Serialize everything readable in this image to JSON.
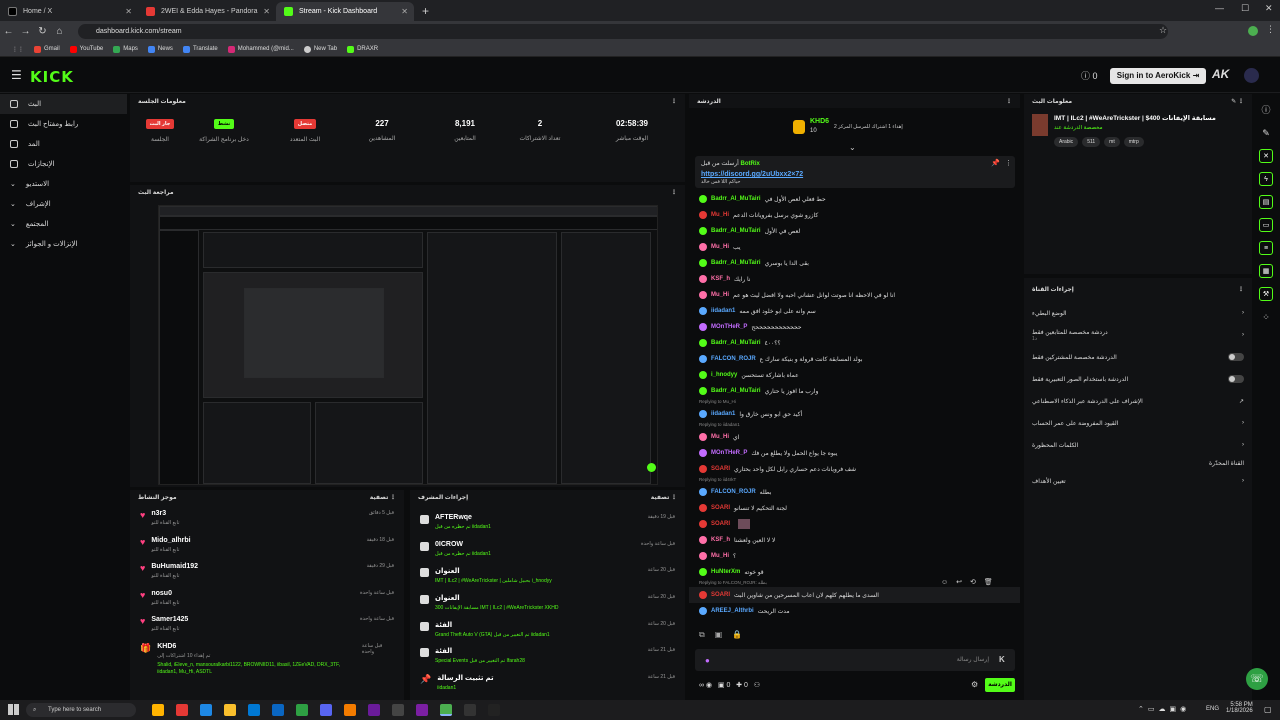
{
  "browser": {
    "tabs": [
      {
        "label": "Home / X",
        "favicon_color": "#000000",
        "active": false
      },
      {
        "label": "2WEI & Edda Hayes - Pandora",
        "favicon_color": "#e53935",
        "active": false
      },
      {
        "label": "Stream - Kick Dashboard",
        "favicon_color": "#53fc18",
        "active": true
      }
    ],
    "url": "dashboard.kick.com/stream",
    "bookmarks": [
      "Gmail",
      "YouTube",
      "Maps",
      "News",
      "Translate",
      "Mohammed (@mid...",
      "New Tab",
      "DRAXR"
    ]
  },
  "app": {
    "logo": "KICK",
    "notif_count": "0",
    "signin_label": "Sign in to AeroKick"
  },
  "sidebar": {
    "items": [
      {
        "label": "البث"
      },
      {
        "label": "رابط ومفتاح البث"
      },
      {
        "label": "المد"
      },
      {
        "label": "الإنجازات"
      },
      {
        "label": "الاستديو"
      },
      {
        "label": "الإشراف"
      },
      {
        "label": "المجتمع"
      },
      {
        "label": "الإنزالات و الجوائز"
      }
    ]
  },
  "session": {
    "title": "معلومات الجلسة",
    "stats": [
      {
        "value": "جار البث",
        "label": "الجلسة",
        "badge_color": "#e53935"
      },
      {
        "value": "نشط",
        "label": "دخل برنامج الشراكة",
        "badge_color": "#53fc18"
      },
      {
        "value": "متصل",
        "label": "البث المتعدد",
        "badge_color": "#e53935"
      },
      {
        "value": "227",
        "label": "المشاهدين"
      },
      {
        "value": "8,191",
        "label": "المتابعين"
      },
      {
        "value": "2",
        "label": "تعداد الاشتراكات"
      },
      {
        "value": "02:58:39",
        "label": "الوقت مباشر"
      }
    ]
  },
  "preview": {
    "title": "مراجعة البث"
  },
  "activity": {
    "title": "موجز النشاط",
    "filter_label": "تصفية",
    "items": [
      {
        "name": "n3r3",
        "sub": "تابع القناة للتو",
        "time": "قبل 5 دقائق"
      },
      {
        "name": "Mido_alhrbi",
        "sub": "تابع القناة للتو",
        "time": "قبل 18 دقيقة"
      },
      {
        "name": "BuHumaid192",
        "sub": "تابع القناة للتو",
        "time": "قبل 29 دقيقة"
      },
      {
        "name": "nosu0",
        "sub": "تابع القناة للتو",
        "time": "قبل ساعة واحدة"
      },
      {
        "name": "Samer1425",
        "sub": "تابع القناة للتو",
        "time": "قبل ساعة واحدة"
      },
      {
        "name": "KHD6",
        "sub": "تم إهداء 10 اشتراكات إلى",
        "extra": "Shalid, iEleve_n, mansouralkarbi1122, BROWNIID11, iibasil, 1ZEeVAD, DRX_3TF, iidadan1, Mu_Hi, ASDTL",
        "time": "قبل ساعة واحدة"
      }
    ]
  },
  "mod_actions": {
    "title": "إجراءات المشرف",
    "filter_label": "تصفية",
    "items": [
      {
        "name": "AFTERwqe",
        "sub": "تم حظره من قبل iidadan1",
        "time": "قبل 19 دقيقة"
      },
      {
        "name": "0ICROW",
        "sub": "تم حظره من قبل iidadan1",
        "time": "قبل ساعة واحدة"
      },
      {
        "name": "العنوان",
        "sub": "IMT | ILc2 | #WeAreTrickster | بحبيل شاملين i_hnodyy",
        "time": "قبل 20 ساعة"
      },
      {
        "name": "العنوان",
        "sub": "مسابقة الإيفانات 300 IMT | ILc2 | #WeAreTrickster XKHD",
        "time": "قبل 20 ساعة"
      },
      {
        "name": "الفئة",
        "sub": "Grand Theft Auto V (GTA) تم التغيير من قبل iidadan1",
        "time": "قبل 20 ساعة"
      },
      {
        "name": "الفئة",
        "sub": "Special Events تم التغيير من قبل Ifarah28",
        "time": "قبل 21 ساعة"
      },
      {
        "name": "تم تثبيت الرسالة",
        "sub": "iidadan1",
        "time": "قبل 21 ساعة"
      }
    ]
  },
  "chat": {
    "title": "الدردشة",
    "top_gifter": {
      "name": "KHD6",
      "count": "10",
      "note": "إهداء 1 اشتراك للمرسل المركز 2"
    },
    "pinned": {
      "user": "BotRix",
      "prefix": "أرسلت من قبل",
      "text": "https://discord.gg/2uUbxx2×72",
      "sub": "حياكم اللا فس خالد"
    },
    "messages": [
      {
        "user": "Badrr_Al_MuTairi",
        "color": "#53fc18",
        "text": "حط فعلي لعص الأول في"
      },
      {
        "user": "Mu_Hi",
        "color": "#e53935",
        "text": "كازرو شوي برسل بفرويانات الدعم"
      },
      {
        "user": "Badrr_Al_MuTairi",
        "color": "#53fc18",
        "text": "لعص في الأول"
      },
      {
        "user": "Mu_Hi",
        "color": "#ff6fa8",
        "text": "يب"
      },
      {
        "user": "Badrr_Al_MuTairi",
        "color": "#53fc18",
        "text": "بقى الدا يا بوسري"
      },
      {
        "user": "KSF_h",
        "color": "#ff6fa8",
        "text": "نا رايك"
      },
      {
        "user": "Mu_Hi",
        "color": "#ff6fa8",
        "text": "انا لو في الاحظه انا صوتت لوانل عشاني احبه ولا افضل ليث هو عم"
      },
      {
        "user": "iidadan1",
        "color": "#5aa9ff",
        "text": "سم وانه على ابو خلود افق ممه"
      },
      {
        "user": "MOnTHeR_P",
        "color": "#c36cff",
        "text": "ححححححححححححح"
      },
      {
        "user": "Badrr_Al_MuTairi",
        "color": "#53fc18",
        "text": "؟؟٤٠٠"
      },
      {
        "user": "FALCON_ROJR",
        "color": "#5aa9ff",
        "text": "بولد المسابقة كانت قرولة و بنيكة سارك ع"
      },
      {
        "user": "i_hnodyy",
        "color": "#53fc18",
        "text": "عماه باشاركة تستحسن"
      },
      {
        "user": "Badrr_Al_MuTairi",
        "color": "#53fc18",
        "text": "وارب ما افوز يا حتاري"
      },
      {
        "user": "iidadan1",
        "color": "#5aa9ff",
        "text": "أكيد حق ابو ونس خارق وا",
        "reply": "Replying to Mu_Hi"
      },
      {
        "user": "Mu_Hi",
        "color": "#ff6fa8",
        "text": "اي",
        "reply": "Replying to iidadan1"
      },
      {
        "user": "MOnTHeR_P",
        "color": "#c36cff",
        "text": "يبوه جا يواع الحمل ولا يطلع من فك"
      },
      {
        "user": "SGARI",
        "color": "#e53935",
        "text": "شف فرويانات دعم حساري رابل لكل واحد بحتاري"
      },
      {
        "user": "FALCON_ROJR",
        "color": "#5aa9ff",
        "text": "بطله",
        "reply": "Replying to iid4rkT"
      },
      {
        "user": "SOARI",
        "color": "#e53935",
        "text": "لجنة التحكيم لا تنسانو"
      },
      {
        "user": "SOARI",
        "color": "#e53935",
        "text": ""
      },
      {
        "user": "KSF_h",
        "color": "#ff6fa8",
        "text": "لا لا العين ولعشنا"
      },
      {
        "user": "Mu_Hi",
        "color": "#ff6fa8",
        "text": "؟"
      },
      {
        "user": "HuNterXm",
        "color": "#53fc18",
        "text": "قو خوته"
      },
      {
        "user": "SOARI",
        "color": "#e53935",
        "text": "السدى ما يطلهم كلهم لان اعاب المسرحين من شاوين البث",
        "reply": "Replying to FALCON_ROJR: بطله"
      },
      {
        "user": "AREEJ_Althrbi",
        "color": "#5aa9ff",
        "text": "مدت الريحت"
      }
    ],
    "input_placeholder": "إرسال رسالة",
    "send_label": "الدردشة",
    "footer_count": "0",
    "footer_count2": "0"
  },
  "stream_info": {
    "title": "معلومات البث",
    "stream_title": "IMT | ILc2 | #WeAreTrickster | $400 مسابقة الإيفانات",
    "category": "مخصصة الدردشة عند",
    "tags": [
      "Arabic",
      "511",
      "mt",
      "mtrp"
    ]
  },
  "channel_actions": {
    "title": "إجراءات القناة",
    "items": [
      {
        "label": "الوضع البطيء",
        "control": "chevron"
      },
      {
        "label": "دردشة مخصصة للمتابعين فقط",
        "sub": "1د",
        "control": "chevron"
      },
      {
        "label": "الدردشة مخصصة للمشتركين فقط",
        "control": "toggle"
      },
      {
        "label": "الدردشة باستخدام الصور التعبيرية فقط",
        "control": "toggle"
      },
      {
        "label": "الإشراف على الدردشة عبر الذكاء الاصطناعي",
        "control": "link"
      },
      {
        "label": "القيود المفروضة على عمر الحساب",
        "control": "chevron"
      },
      {
        "label": "الكلمات المحظورة",
        "control": "chevron"
      },
      {
        "label": "القناة المحدّرة",
        "control": "none"
      },
      {
        "label": "تعيين الأهداف",
        "control": "chevron"
      }
    ]
  },
  "taskbar": {
    "search_placeholder": "Type here to search",
    "language": "ENG",
    "time": "5:58 PM",
    "date": "1/18/2026"
  },
  "colors": {
    "accent": "#53fc18",
    "live": "#e53935"
  }
}
